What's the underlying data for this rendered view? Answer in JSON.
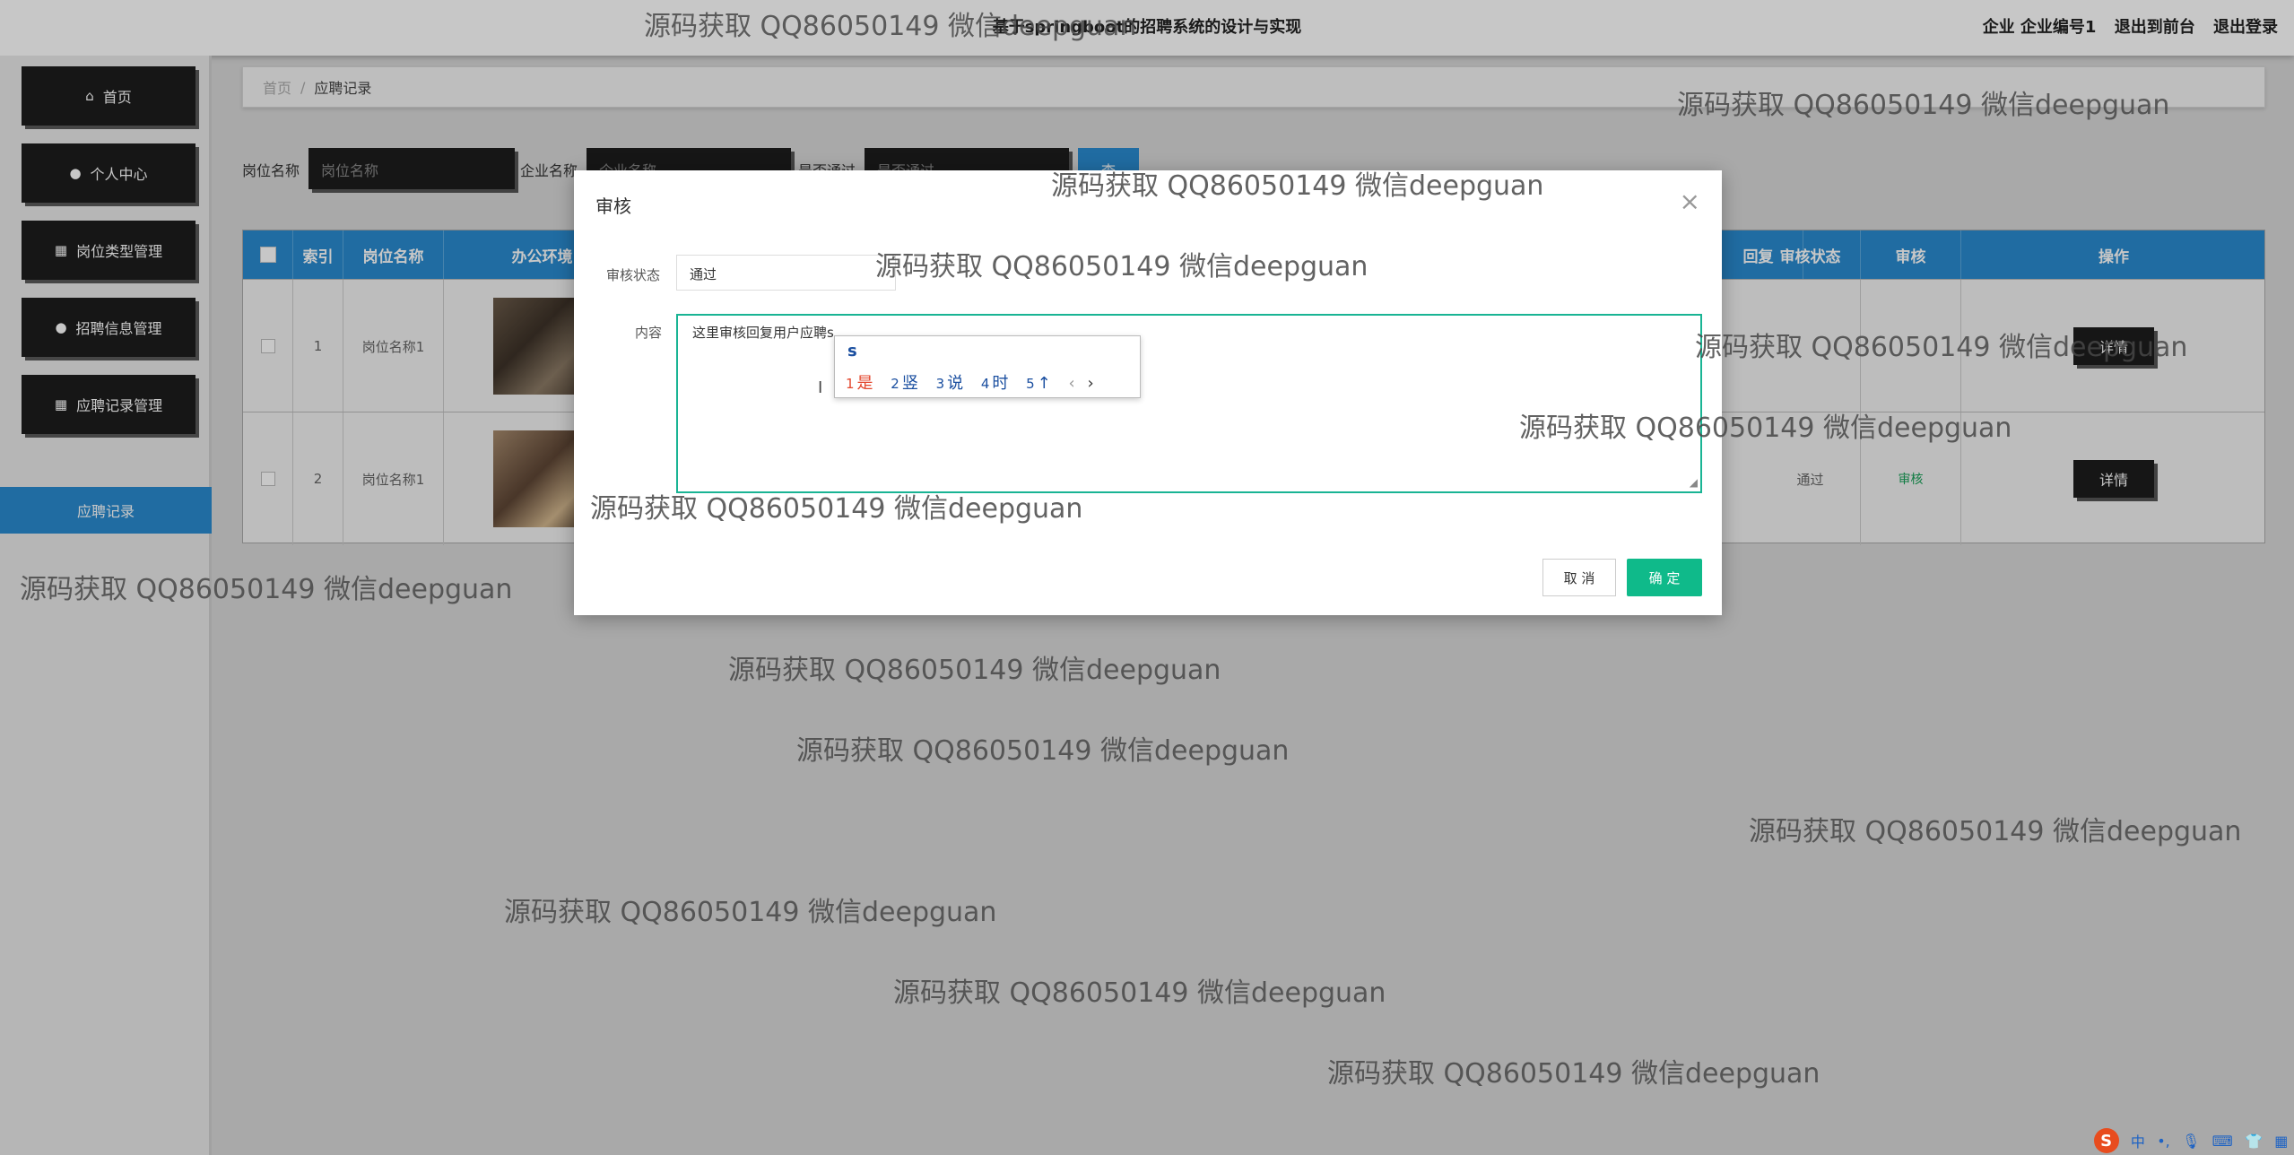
{
  "header": {
    "title": "基于springboot的招聘系统的设计与实现",
    "user": "企业 企业编号1",
    "to_front": "退出到前台",
    "logout": "退出登录"
  },
  "sidebar": {
    "items": [
      {
        "label": "首页",
        "icon": "home-icon"
      },
      {
        "label": "个人中心",
        "icon": "user-icon"
      },
      {
        "label": "岗位类型管理",
        "icon": "grid-icon"
      },
      {
        "label": "招聘信息管理",
        "icon": "user-icon"
      },
      {
        "label": "应聘记录管理",
        "icon": "grid-icon"
      }
    ],
    "sub_item": "应聘记录"
  },
  "breadcrumb": {
    "home": "首页",
    "current": "应聘记录"
  },
  "search": {
    "job_label": "岗位名称",
    "job_placeholder": "岗位名称",
    "company_label": "企业名称",
    "company_placeholder": "企业名称",
    "pass_label": "是否通过",
    "pass_placeholder": "是否通过",
    "query_button": "查询"
  },
  "table": {
    "headers": [
      "索引",
      "岗位名称",
      "办公环境",
      "回复",
      "审核状态",
      "审核",
      "操作"
    ],
    "rows": [
      {
        "index": "1",
        "job": "岗位名称1",
        "status": "",
        "audit": "",
        "action": "详情"
      },
      {
        "index": "2",
        "job": "岗位名称1",
        "status": "通过",
        "audit": "审核",
        "action": "详情"
      }
    ]
  },
  "modal": {
    "title": "审核",
    "status_label": "审核状态",
    "status_value": "通过",
    "content_label": "内容",
    "content_value": "这里审核回复用户应聘s",
    "cancel": "取 消",
    "confirm": "确 定"
  },
  "ime": {
    "input": "s",
    "candidates": [
      {
        "n": "1",
        "c": "是"
      },
      {
        "n": "2",
        "c": "竖"
      },
      {
        "n": "3",
        "c": "说"
      },
      {
        "n": "4",
        "c": "时"
      },
      {
        "n": "5",
        "c": "↑"
      }
    ],
    "prev": "‹",
    "next": "›"
  },
  "watermark": "源码获取 QQ86050149 微信deepguan",
  "tray": {
    "lang": "中",
    "logo": "S"
  }
}
